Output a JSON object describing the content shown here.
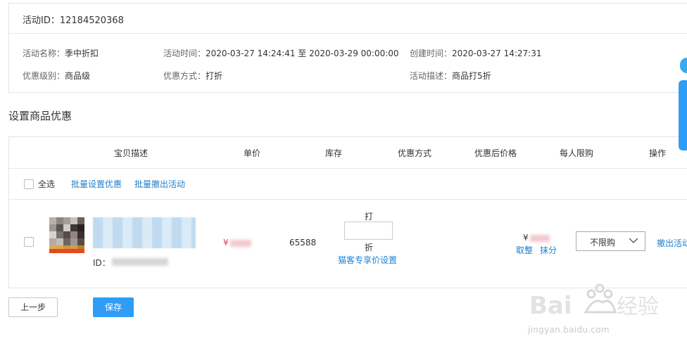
{
  "info": {
    "activity_id_label": "活动ID：",
    "activity_id": "12184520368",
    "name_label": "活动名称：",
    "name": "季中折扣",
    "time_label": "活动时间：",
    "time": "2020-03-27 14:24:41 至 2020-03-29 00:00:00",
    "created_label": "创建时间：",
    "created": "2020-03-27 14:27:31",
    "level_label": "优惠级别：",
    "level": "商品级",
    "method_label": "优惠方式：",
    "method": "打折",
    "desc_label": "活动描述：",
    "desc": "商品打5折"
  },
  "section_title": "设置商品优惠",
  "table": {
    "headers": {
      "desc": "宝贝描述",
      "price": "单价",
      "stock": "库存",
      "discount_method": "优惠方式",
      "final_price": "优惠后价格",
      "limit": "每人限购",
      "action": "操作"
    },
    "tools": {
      "select_all": "全选",
      "batch_set": "批量设置优惠",
      "batch_revoke": "批量撤出活动"
    },
    "row": {
      "id_label": "ID：",
      "price_symbol": "¥",
      "stock": "65588",
      "da_label": "打",
      "discount_value": "",
      "zhe_label": "折",
      "vip_link": "猫客专享价设置",
      "final_symbol": "¥",
      "round_int": "取整",
      "round_fen": "抹分",
      "limit_value": "不限购",
      "revoke": "撤出活动"
    }
  },
  "buttons": {
    "prev": "上一步",
    "save": "保存"
  },
  "watermark": {
    "url": "jingyan.baidu.com"
  },
  "colors": {
    "link": "#1c7fd0",
    "primary": "#2f9df5",
    "price": "#e4393c"
  }
}
